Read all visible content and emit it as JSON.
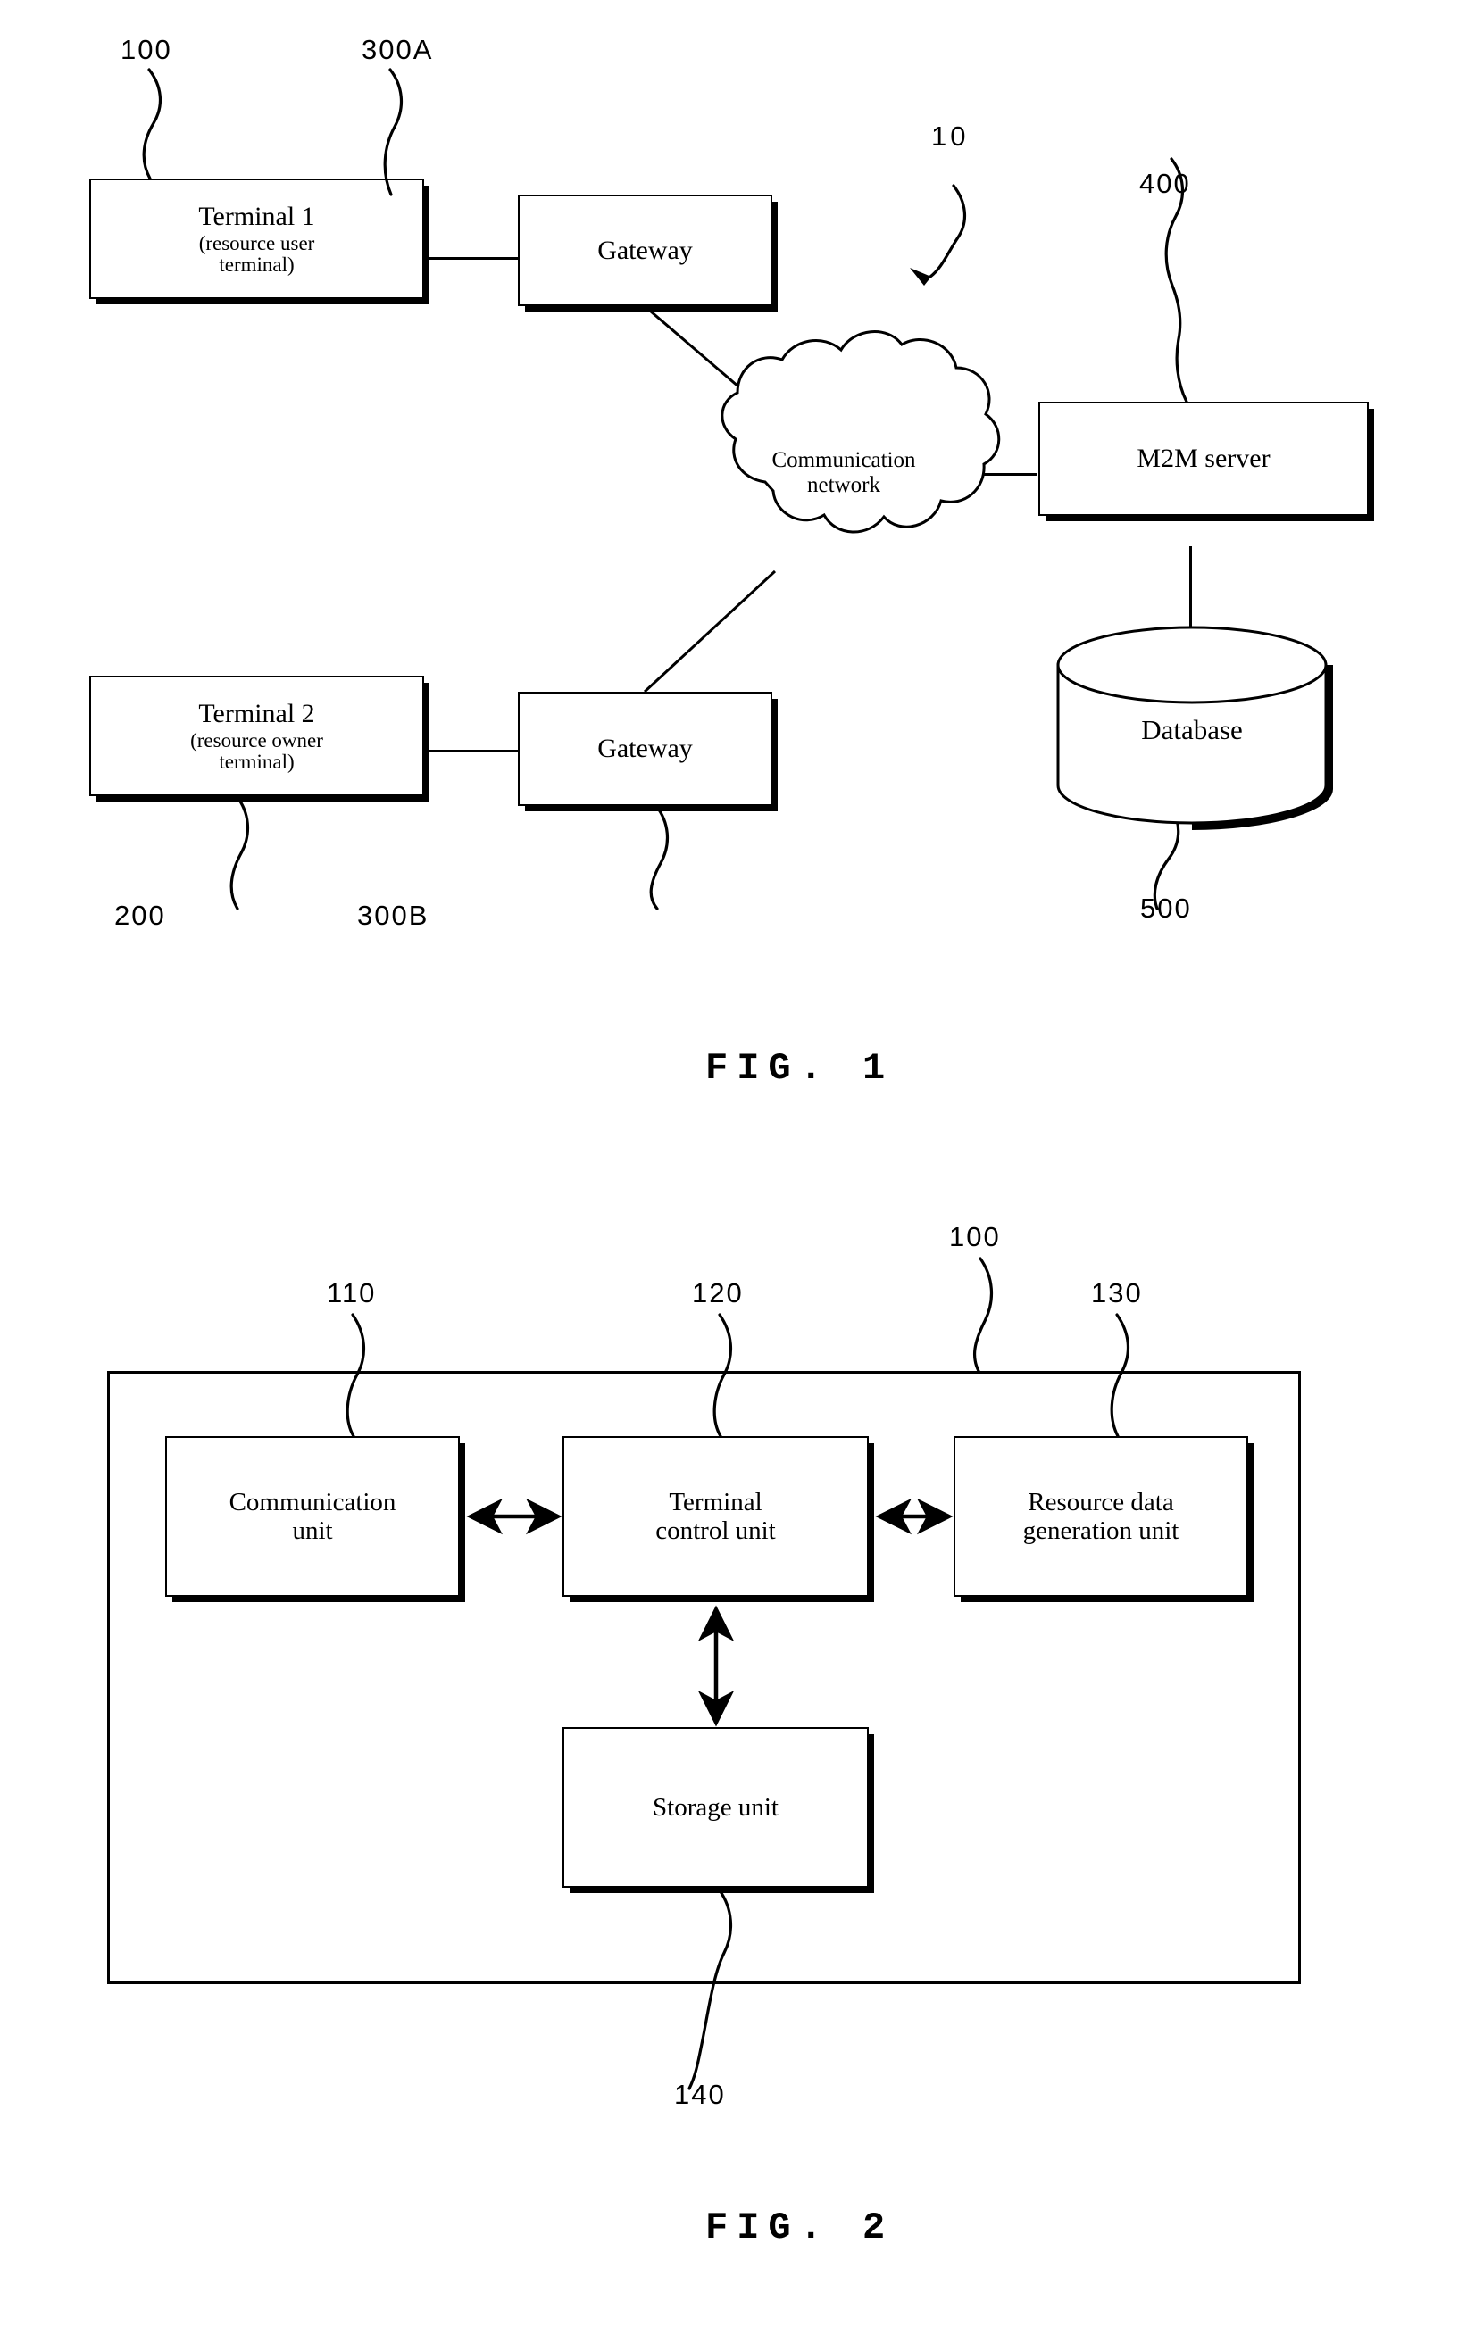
{
  "document": {
    "kind": "patent-drawing-sheet",
    "background_color": "#ffffff",
    "ink_color": "#000000"
  },
  "figure1": {
    "caption": "FIG. 1",
    "system_ref": "10",
    "nodes": [
      {
        "id": "terminal1",
        "title": "Terminal 1",
        "subtitle_line1": "(resource user",
        "subtitle_line2": "terminal)",
        "ref": "100"
      },
      {
        "id": "gateway_a",
        "title": "Gateway",
        "ref": "300A"
      },
      {
        "id": "terminal2",
        "title": "Terminal 2",
        "subtitle_line1": "(resource owner",
        "subtitle_line2": "terminal)",
        "ref": "200"
      },
      {
        "id": "gateway_b",
        "title": "Gateway",
        "ref": "300B"
      },
      {
        "id": "m2m_server",
        "title": "M2M server",
        "ref": "400"
      },
      {
        "id": "database",
        "title": "Database",
        "ref": "500"
      },
      {
        "id": "cloud",
        "title_line1": "Communication",
        "title_line2": "network"
      }
    ],
    "connections": [
      {
        "from": "terminal1",
        "to": "gateway_a",
        "style": "straight"
      },
      {
        "from": "gateway_a",
        "to": "cloud",
        "style": "diagonal"
      },
      {
        "from": "terminal2",
        "to": "gateway_b",
        "style": "straight"
      },
      {
        "from": "gateway_b",
        "to": "cloud",
        "style": "diagonal"
      },
      {
        "from": "cloud",
        "to": "m2m_server",
        "style": "straight"
      },
      {
        "from": "m2m_server",
        "to": "database",
        "style": "straight"
      }
    ]
  },
  "figure2": {
    "caption": "FIG. 2",
    "container_ref": "100",
    "nodes": [
      {
        "id": "communication_unit",
        "title_line1": "Communication",
        "title_line2": "unit",
        "ref": "110"
      },
      {
        "id": "terminal_control_unit",
        "title_line1": "Terminal",
        "title_line2": "control unit",
        "ref": "120"
      },
      {
        "id": "resource_data_generation_unit",
        "title_line1": "Resource data",
        "title_line2": "generation unit",
        "ref": "130"
      },
      {
        "id": "storage_unit",
        "title_line1": "Storage unit",
        "title_line2": "",
        "ref": "140"
      }
    ],
    "connections": [
      {
        "from": "communication_unit",
        "to": "terminal_control_unit",
        "arrows": "both"
      },
      {
        "from": "terminal_control_unit",
        "to": "resource_data_generation_unit",
        "arrows": "both"
      },
      {
        "from": "terminal_control_unit",
        "to": "storage_unit",
        "arrows": "both"
      }
    ]
  }
}
